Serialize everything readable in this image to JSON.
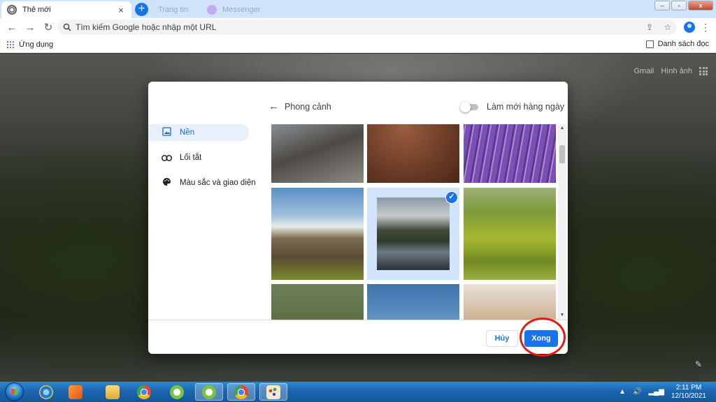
{
  "browser": {
    "active_tab": {
      "title": "Thẻ mới",
      "close": "×"
    },
    "background_tabs": [
      {
        "title": "Trang tin"
      },
      {
        "title": "Messenger"
      }
    ],
    "new_tab_label": "+",
    "window_controls": {
      "minimize": "–",
      "maximize": "▫",
      "close": "x"
    },
    "nav": {
      "back": "←",
      "forward": "→",
      "reload": "↻"
    },
    "omnibox": {
      "placeholder": "Tìm kiếm Google hoặc nhập một URL"
    },
    "bookmarks": {
      "apps_label": "Ứng dụng",
      "reading_list_label": "Danh sách đọc"
    }
  },
  "ntp": {
    "links": [
      "Gmail",
      "Hình ảnh"
    ]
  },
  "dialog": {
    "title": "Phong cảnh",
    "refresh_daily_label": "Làm mới hàng ngày",
    "refresh_daily_on": false,
    "sidebar": [
      {
        "label": "Nền",
        "icon": "image-icon",
        "selected": true
      },
      {
        "label": "Lối tắt",
        "icon": "link-icon",
        "selected": false
      },
      {
        "label": "Màu sắc và giao diện",
        "icon": "palette-icon",
        "selected": false
      }
    ],
    "selected_image_index": 4,
    "cancel_label": "Hủy",
    "done_label": "Xong"
  },
  "taskbar": {
    "time": "2:11 PM",
    "date": "12/10/2021"
  },
  "colors": {
    "accent": "#1a73e8",
    "highlight_ring": "#e11a1a",
    "selected_nav_bg": "#e8f0fe"
  }
}
